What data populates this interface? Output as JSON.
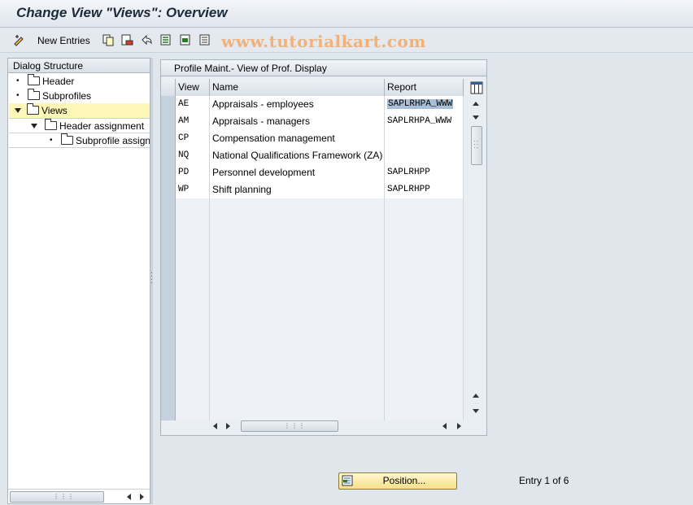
{
  "window": {
    "title": "Change View \"Views\": Overview"
  },
  "toolbar": {
    "new_entries_label": "New Entries"
  },
  "watermark": "www.tutorialkart.com",
  "dialog_structure": {
    "header": "Dialog Structure",
    "items": [
      {
        "label": "Header",
        "level": 0,
        "expanded": false
      },
      {
        "label": "Subprofiles",
        "level": 0,
        "expanded": false
      },
      {
        "label": "Views",
        "level": 0,
        "expanded": true,
        "selected": true
      },
      {
        "label": "Header assignment",
        "level": 1,
        "expanded": true
      },
      {
        "label": "Subprofile assignr",
        "level": 2,
        "expanded": false
      }
    ]
  },
  "table": {
    "title": "Profile Maint.- View of Prof. Display",
    "columns": [
      "View",
      "Name",
      "Report"
    ],
    "rows": [
      {
        "view": "AE",
        "name": "Appraisals - employees",
        "report": "SAPLRHPA_WWW"
      },
      {
        "view": "AM",
        "name": "Appraisals - managers",
        "report": "SAPLRHPA_WWW"
      },
      {
        "view": "CP",
        "name": "Compensation management",
        "report": ""
      },
      {
        "view": "NQ",
        "name": "National Qualifications Framework (ZA)",
        "report": ""
      },
      {
        "view": "PD",
        "name": "Personnel development",
        "report": "SAPLRHPP"
      },
      {
        "view": "WP",
        "name": "Shift planning",
        "report": "SAPLRHPP"
      }
    ]
  },
  "footer": {
    "position_button": "Position...",
    "entry_text": "Entry 1 of 6"
  }
}
